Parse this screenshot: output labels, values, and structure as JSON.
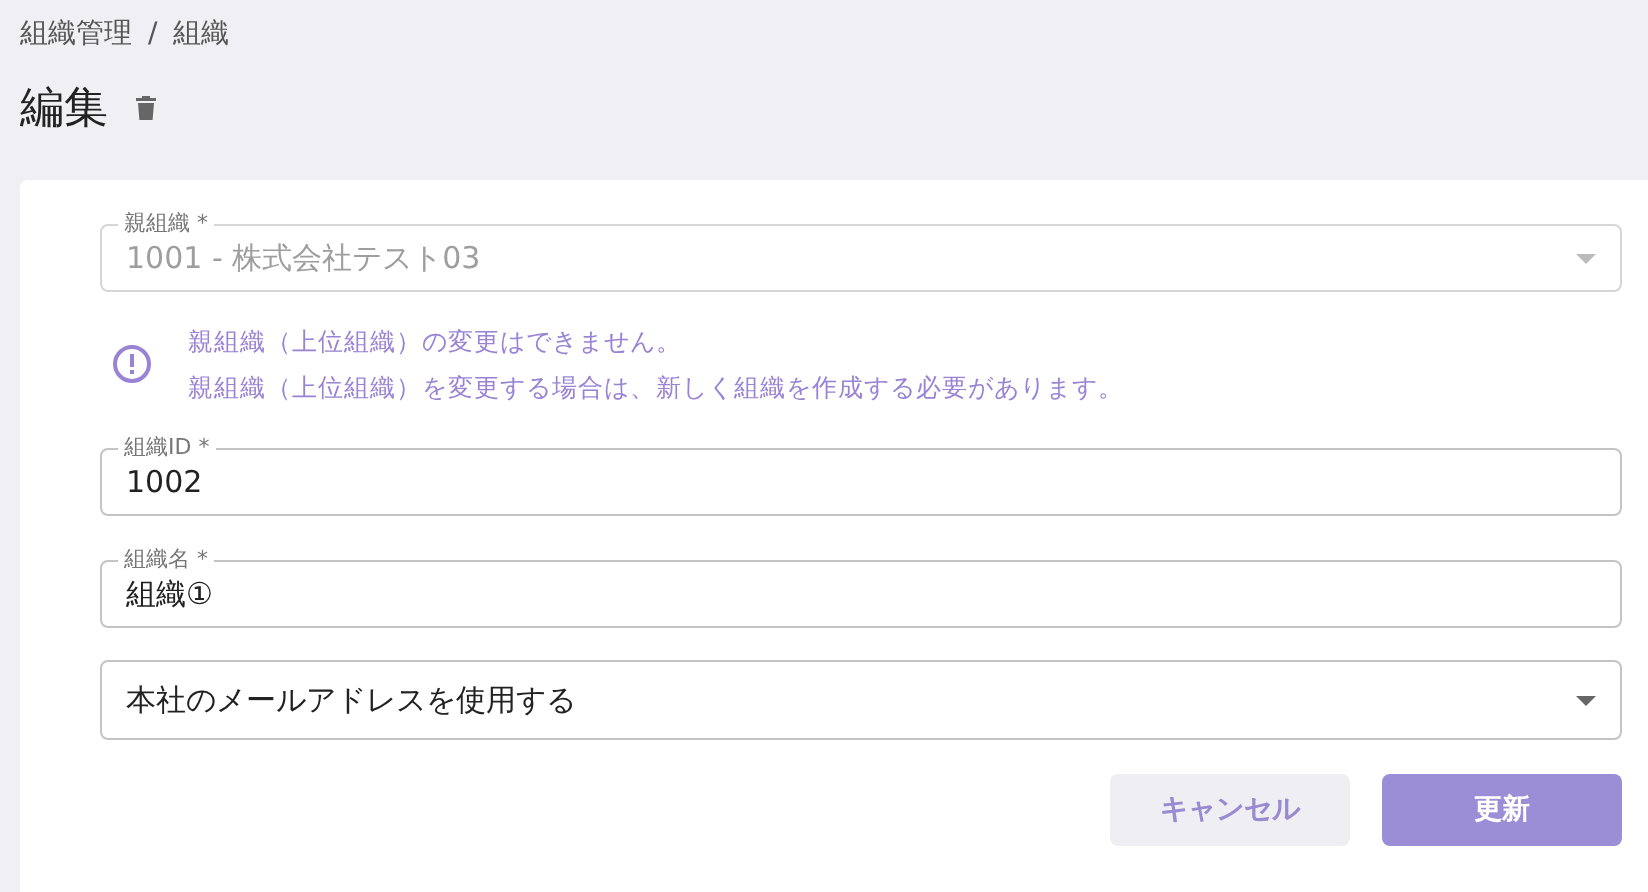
{
  "breadcrumb": [
    "組織管理",
    "組織"
  ],
  "breadcrumb_separator": "/",
  "page_title": "編集",
  "fields": [
    {
      "kind": "select",
      "label": "親組織 *",
      "value": "1001 - 株式会社テスト03",
      "disabled": true
    },
    {
      "kind": "notice",
      "lines": [
        "親組織（上位組織）の変更はできません。",
        "親組織（上位組織）を変更する場合は、新しく組織を作成する必要があります。"
      ]
    },
    {
      "kind": "text",
      "label": "組織ID *",
      "value": "1002",
      "disabled": false
    },
    {
      "kind": "text",
      "label": "組織名 *",
      "value": "組織①",
      "disabled": false
    },
    {
      "kind": "select",
      "value": "本社のメールアドレスを使用する",
      "disabled": false
    }
  ],
  "buttons": [
    {
      "label": "キャンセル",
      "kind": "secondary"
    },
    {
      "label": "更新",
      "kind": "primary"
    }
  ]
}
